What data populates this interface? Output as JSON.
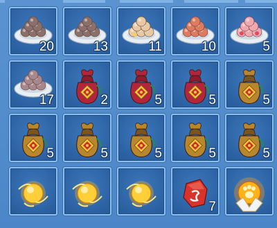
{
  "inventory": {
    "slots": [
      {
        "item": "ball-plate-brown-icon",
        "count": "20"
      },
      {
        "item": "ball-plate-brown-icon",
        "count": "13"
      },
      {
        "item": "ball-plate-cream-icon",
        "count": "11"
      },
      {
        "item": "ball-plate-red-icon",
        "count": "10"
      },
      {
        "item": "ball-plate-pink-rose-icon",
        "count": "5"
      },
      {
        "item": "ball-plate-mauve-icon",
        "count": "17"
      },
      {
        "item": "lucky-bag-red-icon",
        "count": "2"
      },
      {
        "item": "lucky-bag-red-icon",
        "count": "5"
      },
      {
        "item": "lucky-bag-red-icon",
        "count": "5"
      },
      {
        "item": "lucky-bag-gold-icon",
        "count": "5"
      },
      {
        "item": "lucky-bag-gold-icon",
        "count": "5"
      },
      {
        "item": "lucky-bag-gold-icon",
        "count": "5"
      },
      {
        "item": "lucky-bag-gold-icon",
        "count": "5"
      },
      {
        "item": "lucky-bag-gold-icon",
        "count": "5"
      },
      {
        "item": "lucky-bag-gold-icon",
        "count": "5"
      },
      {
        "item": "golden-orb-icon",
        "count": ""
      },
      {
        "item": "golden-orb-icon",
        "count": ""
      },
      {
        "item": "golden-orb-icon",
        "count": ""
      },
      {
        "item": "red-rune-stone-icon",
        "count": "7"
      },
      {
        "item": "paw-flame-orb-icon",
        "count": ""
      }
    ]
  },
  "colors": {
    "ball_brown": "#8a6f6a",
    "ball_cream": "#e8c9a3",
    "ball_red": "#e07a5f",
    "ball_pink": "#f2a6b0",
    "ball_mauve": "#a7878a",
    "bag_red": "#b2253a",
    "bag_gold": "#b8862c",
    "orb_gold": "#ffb21a",
    "rune_red": "#d8342b"
  }
}
